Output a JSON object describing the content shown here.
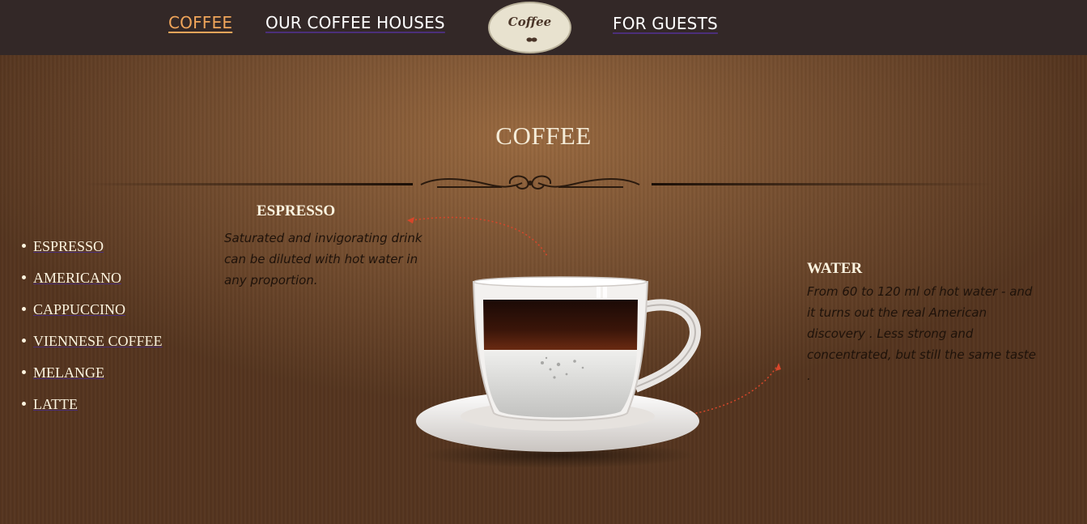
{
  "nav": {
    "items": [
      {
        "label": "COFFEE",
        "active": true
      },
      {
        "label": "OUR COFFEE HOUSES",
        "active": false
      },
      {
        "label": "FOR GUESTS",
        "active": false
      }
    ],
    "logo_text": "Coffee"
  },
  "page": {
    "title": "COFFEE"
  },
  "menu": {
    "items": [
      "ESPRESSO",
      "AMERICANO",
      "CAPPUCCINO",
      "VIENNESE COFFEE",
      "MELANGE",
      "LATTE"
    ]
  },
  "espresso": {
    "title": "ESPRESSO",
    "description": "Saturated and invigorating drink can be diluted with hot water in any proportion."
  },
  "water": {
    "title": "WATER",
    "description": "From 60 to 120 ml of hot water - and it turns out the real American discovery . Less strong and concentrated, but still the same taste ."
  },
  "colors": {
    "topbar": "#332827",
    "active_nav": "#f0a55a",
    "text_light": "#fbf3df",
    "text_dark": "#1e120a",
    "arrow": "#d8462a"
  }
}
